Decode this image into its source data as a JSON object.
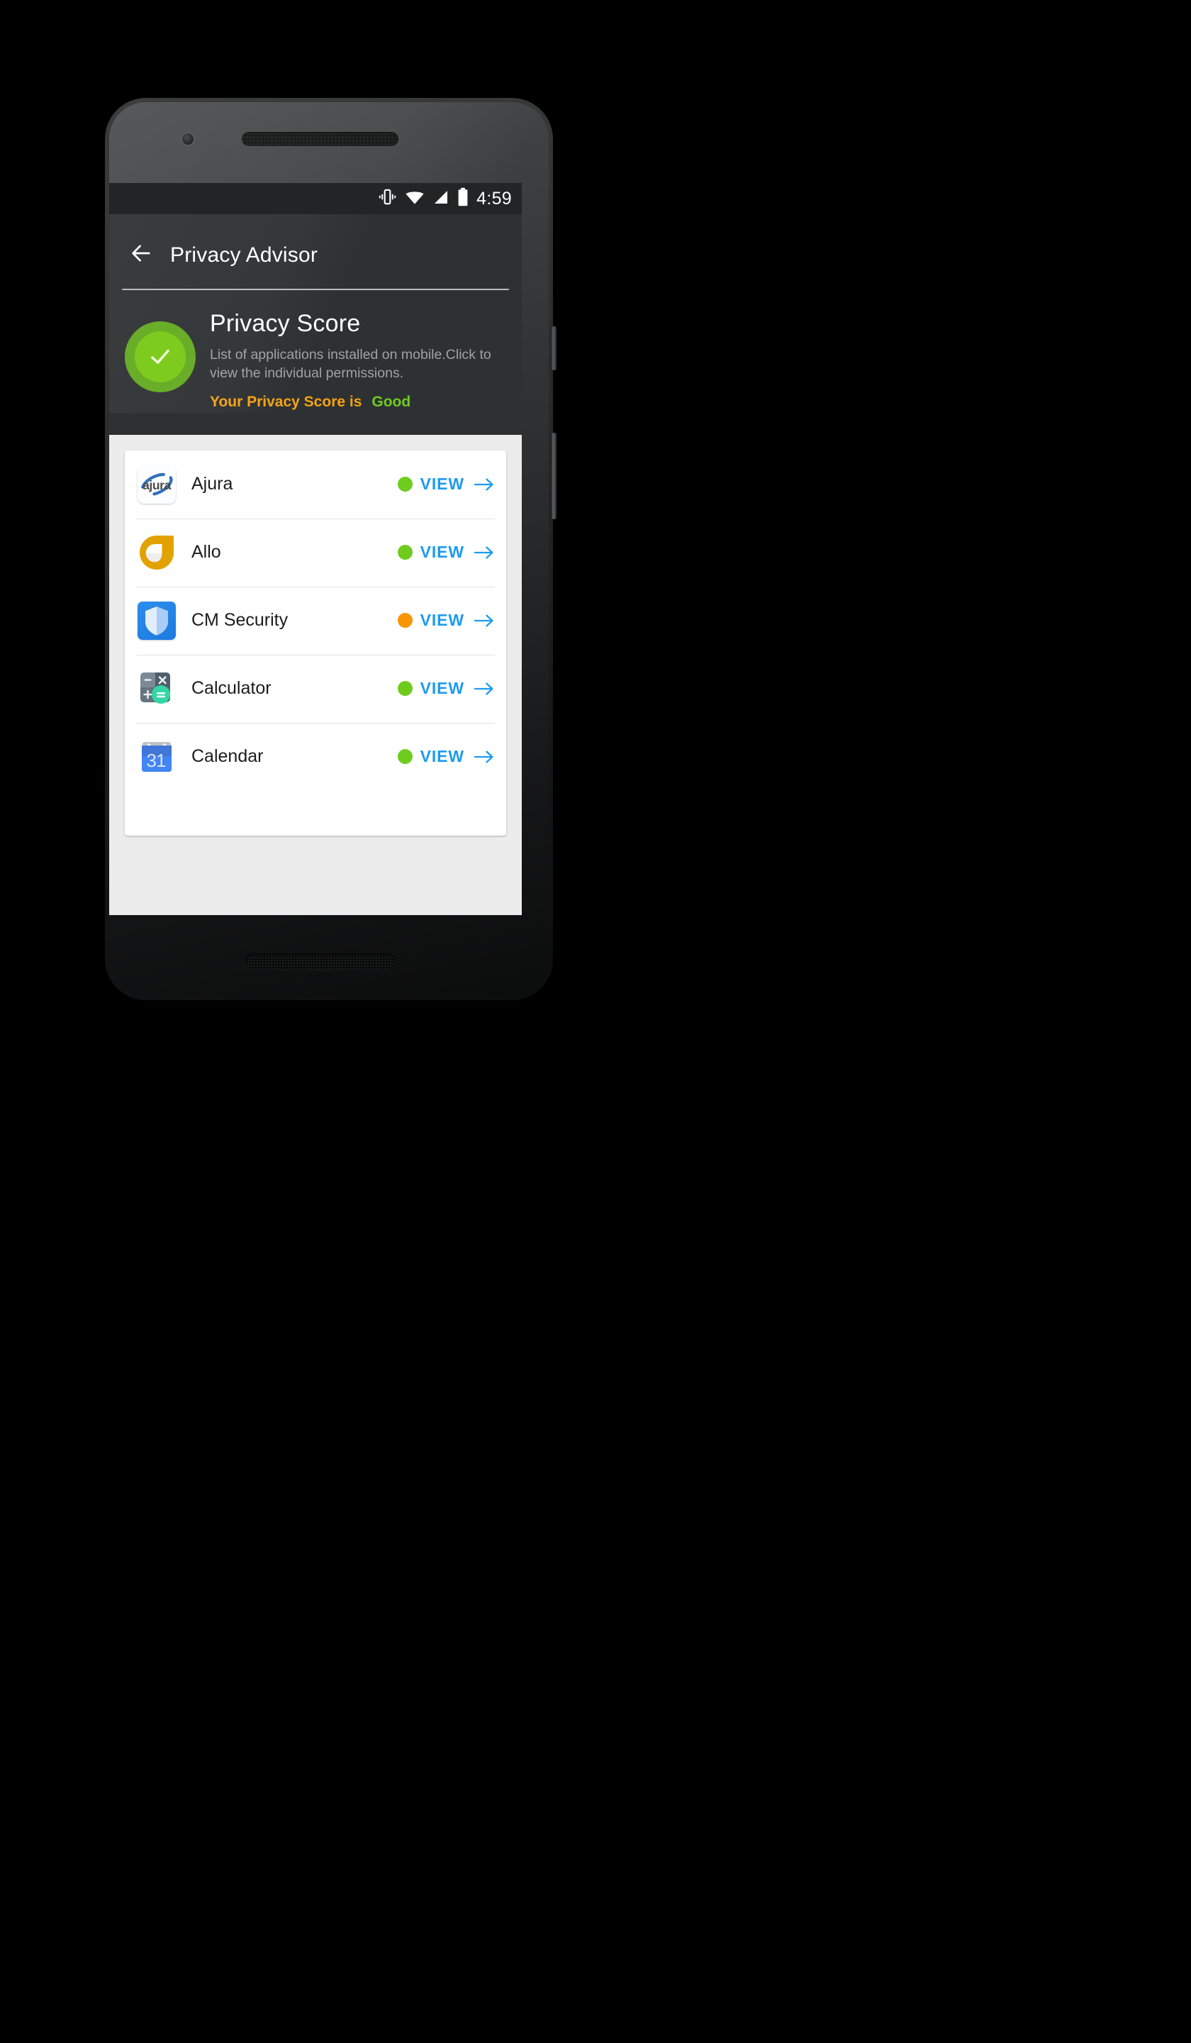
{
  "statusbar": {
    "time": "4:59",
    "icons": [
      "vibrate-icon",
      "wifi-icon",
      "signal-icon",
      "battery-icon"
    ]
  },
  "appbar": {
    "back_icon": "back-arrow-icon",
    "title": "Privacy Advisor"
  },
  "hero": {
    "badge_icon": "check-circle-icon",
    "title": "Privacy Score",
    "description": "List of applications installed on mobile.Click to view the individual permissions.",
    "score_label": "Your Privacy Score is",
    "score_value": "Good",
    "colors": {
      "badge_outer": "#6aad28",
      "badge_inner": "#7ecb1f",
      "score_label": "#f5a312",
      "score_value": "#6fcc1f",
      "header_bg": "#2e3133"
    }
  },
  "apps": {
    "view_label": "VIEW",
    "arrow_icon": "arrow-right-icon",
    "status_colors": {
      "good": "#6fcc1f",
      "warning": "#f79604"
    },
    "accent": "#1e9bf0",
    "items": [
      {
        "name": "Ajura",
        "icon": "ajura-app-icon",
        "status": "good",
        "status_color": "#6fcc1f"
      },
      {
        "name": "Allo",
        "icon": "allo-app-icon",
        "status": "good",
        "status_color": "#6fcc1f"
      },
      {
        "name": "CM Security",
        "icon": "cm-security-app-icon",
        "status": "warning",
        "status_color": "#f79604"
      },
      {
        "name": "Calculator",
        "icon": "calculator-app-icon",
        "status": "good",
        "status_color": "#6fcc1f"
      },
      {
        "name": "Calendar",
        "icon": "calendar-app-icon",
        "status": "good",
        "status_color": "#6fcc1f",
        "icon_day": "31"
      }
    ]
  }
}
